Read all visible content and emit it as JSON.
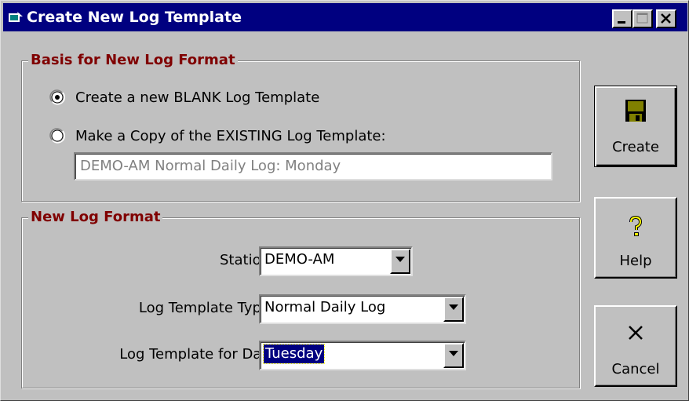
{
  "window": {
    "title": "Create New Log Template"
  },
  "basis_group": {
    "label": "Basis for New Log Format",
    "option_blank": "Create a new BLANK Log Template",
    "option_copy": "Make a Copy of the EXISTING Log Template:",
    "selected": "blank",
    "existing_template": "DEMO-AM Normal Daily Log: Monday"
  },
  "format_group": {
    "label": "New Log Format",
    "station_label": "Station",
    "station_value": "DEMO-AM",
    "type_label": "Log Template Type",
    "type_value": "Normal Daily Log",
    "day_label": "Log Template for Day",
    "day_value": "Tuesday"
  },
  "buttons": {
    "create": "Create",
    "help": "Help",
    "cancel": "Cancel"
  },
  "icons": {
    "create": "floppy-disk-icon",
    "help": "question-mark-icon",
    "cancel": "x-icon"
  },
  "colors": {
    "titlebar": "#000080",
    "group_label": "#800000",
    "face": "#c0c0c0"
  }
}
